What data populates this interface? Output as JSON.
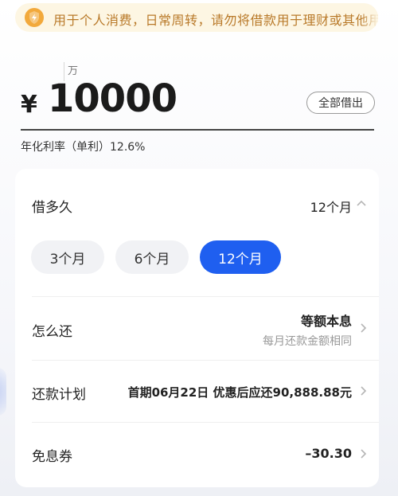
{
  "notice": {
    "text": "用于个人消费，日常周转，请勿将借款用于理财或其他用途"
  },
  "amount": {
    "unit_hint": "万",
    "currency": "¥",
    "value": "10000",
    "borrow_all_label": "全部借出",
    "rate_text": "年化利率（单利）12.6%"
  },
  "term": {
    "label": "借多久",
    "selected": "12个月",
    "options": [
      "3个月",
      "6个月",
      "12个月"
    ]
  },
  "repay": {
    "label": "怎么还",
    "method": "等额本息",
    "method_sub": "每月还款金额相同"
  },
  "plan": {
    "label": "还款计划",
    "summary": "首期06月22日 优惠后应还90,888.88元"
  },
  "coupon": {
    "label": "免息券",
    "value": "–30.30"
  },
  "colors": {
    "accent": "#1f5ff0",
    "notice_bg": "#fdf6e3",
    "notice_text": "#b97a2a",
    "notice_icon": "#f2a93b"
  }
}
